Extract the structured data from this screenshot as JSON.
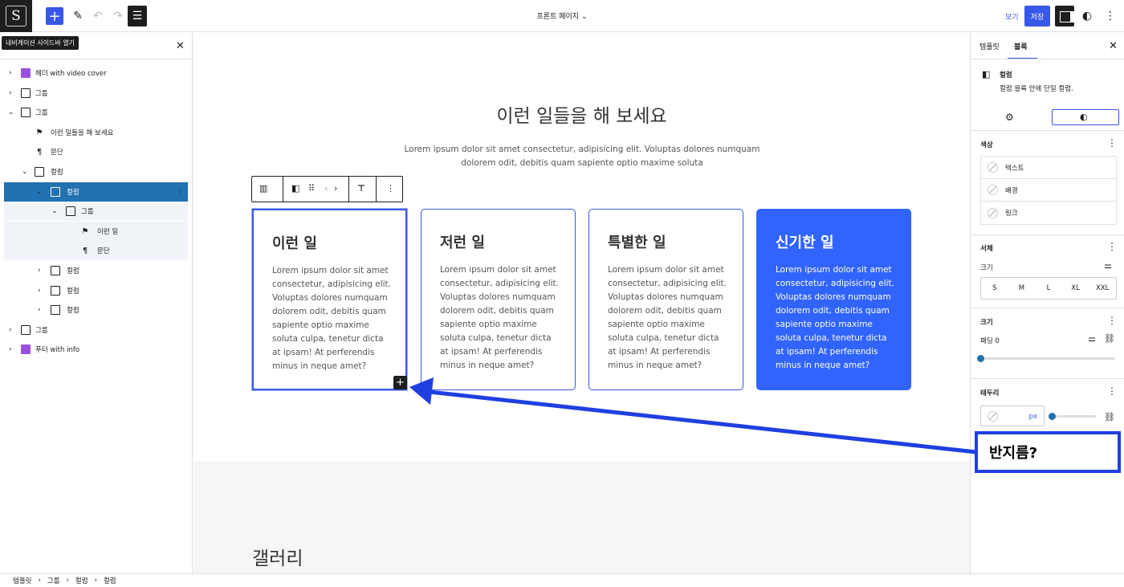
{
  "topbar": {
    "logo": "S",
    "document_title": "프론트 페이지",
    "view_label": "보기",
    "save_label": "저장"
  },
  "left_panel": {
    "tooltip": "내비게이션 사이드바 열기",
    "tree": [
      {
        "label": "헤더 with video cover",
        "icon": "template-part-icon"
      },
      {
        "label": "그룹",
        "icon": "group-icon"
      },
      {
        "label": "그룹",
        "icon": "group-icon"
      },
      {
        "label": "이런 일들을 해 보세요",
        "icon": "heading-icon"
      },
      {
        "label": "문단",
        "icon": "paragraph-icon"
      },
      {
        "label": "컬럼",
        "icon": "columns-icon"
      },
      {
        "label": "컬럼",
        "icon": "column-icon"
      },
      {
        "label": "그룹",
        "icon": "group-icon"
      },
      {
        "label": "이런 일",
        "icon": "heading-icon"
      },
      {
        "label": "문단",
        "icon": "paragraph-icon"
      },
      {
        "label": "컬럼",
        "icon": "column-icon"
      },
      {
        "label": "컬럼",
        "icon": "column-icon"
      },
      {
        "label": "컬럼",
        "icon": "column-icon"
      },
      {
        "label": "그룹",
        "icon": "group-icon"
      },
      {
        "label": "푸터 with info",
        "icon": "template-part-icon"
      }
    ]
  },
  "breadcrumb": [
    "템플릿",
    "그룹",
    "컬럼",
    "컬럼"
  ],
  "canvas": {
    "title": "이런 일들을 해 보세요",
    "description": "Lorem ipsum dolor sit amet consectetur, adipisicing elit. Voluptas dolores numquam dolorem odit, debitis quam sapiente optio maxime soluta",
    "cards": [
      {
        "title": "이런 일",
        "body": "Lorem ipsum dolor sit amet consectetur, adipisicing elit. Voluptas dolores numquam dolorem odit, debitis quam sapiente optio maxime soluta culpa, tenetur dicta at ipsam! At perferendis minus in neque amet?"
      },
      {
        "title": "저런 일",
        "body": "Lorem ipsum dolor sit amet consectetur, adipisicing elit. Voluptas dolores numquam dolorem odit, debitis quam sapiente optio maxime soluta culpa, tenetur dicta at ipsam! At perferendis minus in neque amet?"
      },
      {
        "title": "특별한 일",
        "body": "Lorem ipsum dolor sit amet consectetur, adipisicing elit. Voluptas dolores numquam dolorem odit, debitis quam sapiente optio maxime soluta culpa, tenetur dicta at ipsam! At perferendis minus in neque amet?"
      },
      {
        "title": "신기한 일",
        "body": "Lorem ipsum dolor sit amet consectetur, adipisicing elit. Voluptas dolores numquam dolorem odit, debitis quam sapiente optio maxime soluta culpa, tenetur dicta at ipsam! At perferendis minus in neque amet?"
      }
    ],
    "gallery_title": "갤러리"
  },
  "right_panel": {
    "tabs": [
      "템플릿",
      "블록"
    ],
    "block_name": "컬럼",
    "block_desc": "컬럼 블록 안에 단일 컬럼.",
    "color_section": "색상",
    "colors": [
      "텍스트",
      "배경",
      "링크"
    ],
    "typography_section": "서체",
    "size_label": "크기",
    "sizes": [
      "S",
      "M",
      "L",
      "XL",
      "XXL"
    ],
    "dimensions_section": "크기",
    "padding_label": "패딩 0",
    "border_section": "테두리",
    "border_unit": "px"
  },
  "annotation": {
    "callout_text": "반지름?",
    "accent_color": "#1f3fe0"
  }
}
